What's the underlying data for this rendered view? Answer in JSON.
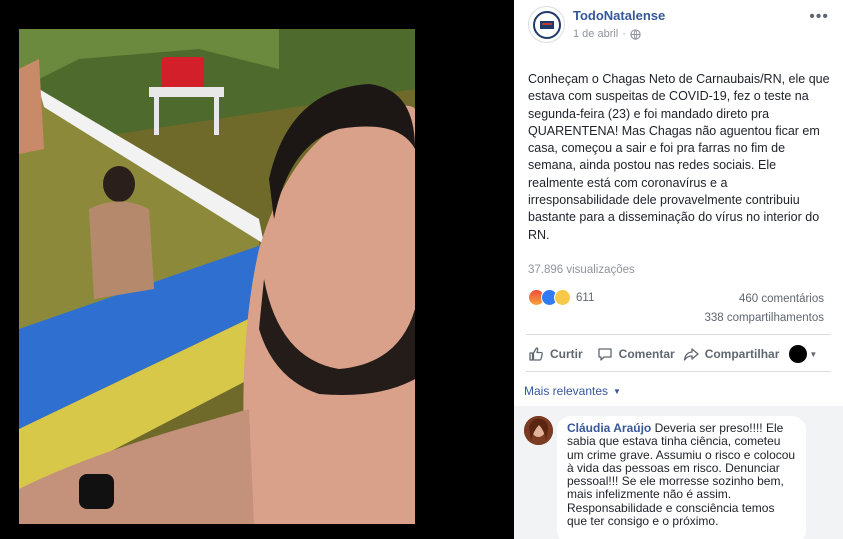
{
  "post": {
    "page_name": "TodoNatalense",
    "date": "1 de abril",
    "privacy_icon": "globe-icon",
    "more_icon": "ellipsis-icon",
    "text": "Conheçam o Chagas Neto de Carnaubais/RN, ele que estava com suspeitas de COVID-19, fez o teste na segunda-feira (23) e foi mandado direto pra QUARENTENA! Mas Chagas não aguentou ficar em casa, começou a sair e foi pra farras no fim de semana, ainda postou nas redes sociais. Ele realmente está com coronavírus e a irresponsabilidade dele provavelmente contribuiu bastante para a disseminação do vírus no interior do RN.",
    "views": "37.896 visualizações",
    "reactions": {
      "icons": [
        "angry-icon",
        "like-icon",
        "sad-icon"
      ],
      "count": "611"
    },
    "comments_count": "460 comentários",
    "shares_count": "338 compartilhamentos"
  },
  "actions": {
    "like": "Curtir",
    "comment": "Comentar",
    "share": "Compartilhar"
  },
  "comments": {
    "sort_label": "Mais relevantes",
    "items": [
      {
        "author": "Cláudia Araújo",
        "text": "Deveria ser preso!!!! Ele sabia que estava tinha ciência, cometeu um crime grave. Assumiu o risco e colocou à vida das pessoas em risco. Denunciar pessoal!!! Se ele morresse sozinho bem, mais infelizmente não é assim. Responsabilidade e consciência temos que ter consigo e o próximo."
      }
    ]
  },
  "colors": {
    "link": "#365899",
    "text": "#1d2129",
    "muted": "#90949c",
    "action": "#606770"
  }
}
